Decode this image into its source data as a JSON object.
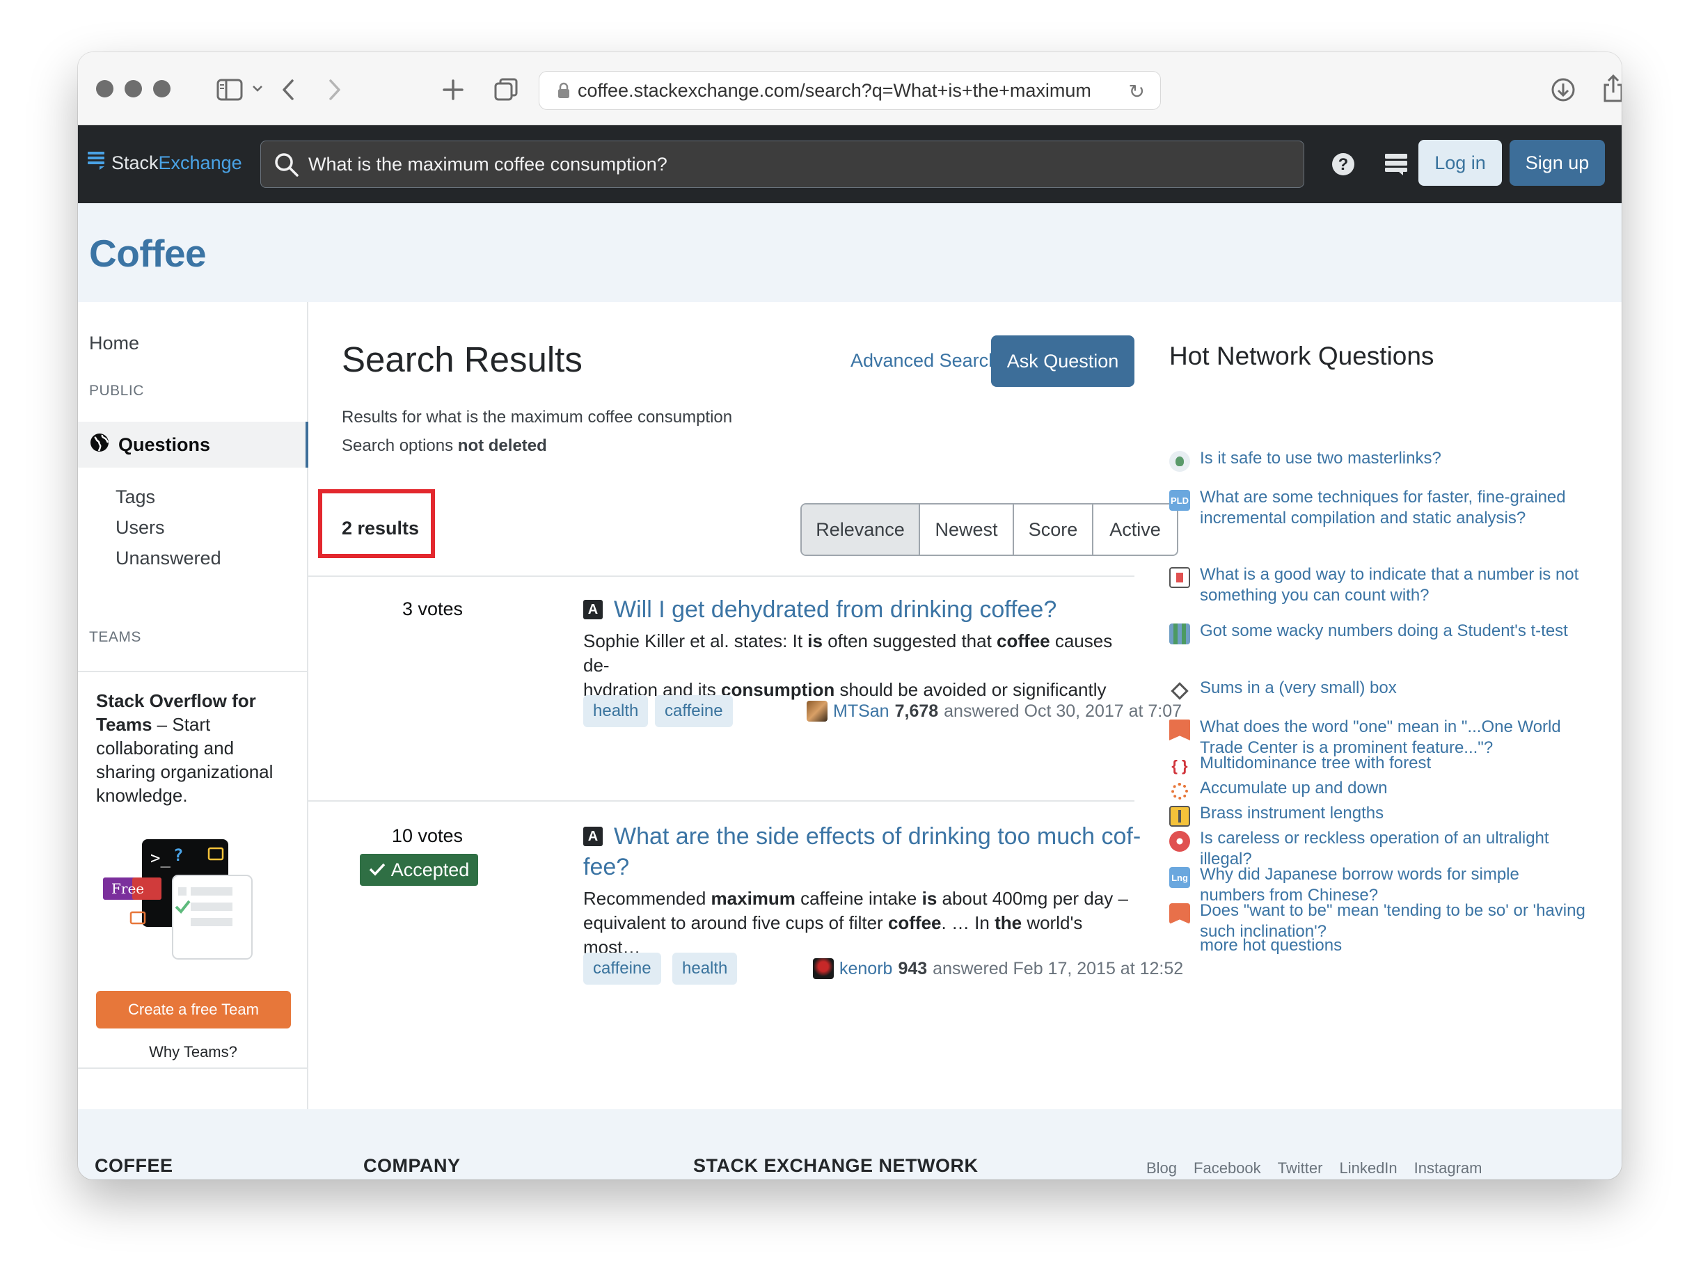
{
  "browser": {
    "url": "coffee.stackexchange.com/search?q=What+is+the+maximum"
  },
  "topbar": {
    "logo_stack": "Stack",
    "logo_exchange": "Exchange",
    "search_value": "What is the maximum coffee consumption?",
    "login_label": "Log in",
    "signup_label": "Sign up"
  },
  "site": {
    "title": "Coffee"
  },
  "leftnav": {
    "home": "Home",
    "public_heading": "PUBLIC",
    "questions": "Questions",
    "tags": "Tags",
    "users": "Users",
    "unanswered": "Unanswered",
    "teams_heading": "TEAMS",
    "teams_bold": "Stack Overflow for Teams",
    "teams_text": " – Start collaborating and sharing organizational knowledge.",
    "free_badge": "Free",
    "create_team": "Create a free Team",
    "why_teams": "Why Teams?"
  },
  "main": {
    "heading": "Search Results",
    "advanced_tips": "Advanced Search Tips",
    "ask_question": "Ask Question",
    "results_for": "Results for what is the maximum coffee consumption",
    "search_options_prefix": "Search options ",
    "search_options_value": "not deleted",
    "results_count": "2 results",
    "sort_options": [
      "Relevance",
      "Newest",
      "Score",
      "Active"
    ],
    "results": [
      {
        "votes": "3 votes",
        "type_badge": "A",
        "title": "Will I get dehydrated from drinking coffee?",
        "excerpt_1a": "Sophie Killer et al. states: It ",
        "excerpt_1b": "is",
        "excerpt_1c": " often suggested that ",
        "excerpt_1d": "coffee",
        "excerpt_1e": " causes de-",
        "excerpt_2a": "hydration and its ",
        "excerpt_2b": "consumption",
        "excerpt_2c": " should be avoided or significantly re-…",
        "tags": [
          "health",
          "caffeine"
        ],
        "user": "MTSan",
        "rep": "7,678",
        "when": "answered Oct 30, 2017 at 7:07"
      },
      {
        "votes": "10 votes",
        "accepted": "Accepted",
        "type_badge": "A",
        "title_line1": "What are the side effects of drinking too much cof-",
        "title_line2": "fee?",
        "excerpt_1a": "Recommended ",
        "excerpt_1b": "maximum",
        "excerpt_1c": " caffeine intake ",
        "excerpt_1d": "is",
        "excerpt_1e": " about 400mg per day –",
        "excerpt_2a": "equivalent to around five cups of filter ",
        "excerpt_2b": "coffee",
        "excerpt_2c": ". … In ",
        "excerpt_2d": "the",
        "excerpt_2e": " world's most…",
        "tags": [
          "caffeine",
          "health"
        ],
        "user": "kenorb",
        "rep": "943",
        "when": "answered Feb 17, 2015 at 12:52"
      }
    ]
  },
  "hot_network": {
    "title": "Hot Network Questions",
    "items": [
      {
        "text": "Is it safe to use two masterlinks?",
        "icon": "bicycles-icon",
        "color": "#e8eef2"
      },
      {
        "text": "What are some techniques for faster, fine-grained incremental compilation and static analysis?",
        "icon": "pld-icon",
        "color": "#6aa7de"
      },
      {
        "text": "What is a good way to indicate that a number is not something you can count with?",
        "icon": "ux-icon",
        "color": "#ffffff"
      },
      {
        "text": "Got some wacky numbers doing a Student's t-test",
        "icon": "crossvalidated-icon",
        "color": "#6f9ec4"
      },
      {
        "text": "Sums in a (very small) box",
        "icon": "puzzling-icon",
        "color": "#ffffff"
      },
      {
        "text": "What does the word \"one\" mean in \"...One World Trade Center is a prominent feature...\"?",
        "icon": "english-icon",
        "color": "#e8704a"
      },
      {
        "text": "Multidominance tree with forest",
        "icon": "tex-icon",
        "color": "#ffffff"
      },
      {
        "text": "Accumulate up and down",
        "icon": "codegolf-icon",
        "color": "#ffffff"
      },
      {
        "text": "Brass instrument lengths",
        "icon": "music-icon",
        "color": "#f4c23a"
      },
      {
        "text": "Is careless or reckless operation of an ultralight illegal?",
        "icon": "aviation-icon",
        "color": "#e05050"
      },
      {
        "text": "Why did Japanese borrow words for simple numbers from Chinese?",
        "icon": "linguistics-icon",
        "color": "#6aa7de"
      },
      {
        "text": "Does \"want to be\" mean 'tending to be so' or 'having such inclination'?",
        "icon": "english-icon",
        "color": "#e8704a"
      }
    ],
    "more": "more hot questions"
  },
  "footer": {
    "col1": "COFFEE",
    "col2": "COMPANY",
    "col3": "STACK EXCHANGE NETWORK",
    "links": [
      "Blog",
      "Facebook",
      "Twitter",
      "LinkedIn",
      "Instagram"
    ]
  }
}
